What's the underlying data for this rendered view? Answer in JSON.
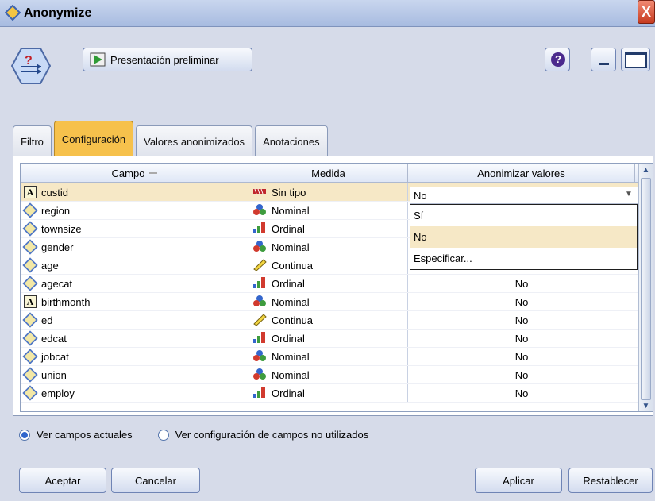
{
  "window": {
    "title": "Anonymize",
    "close_glyph": "X"
  },
  "toolbar": {
    "preview_label": "Presentación preliminar",
    "help_glyph": "?"
  },
  "tabs": [
    {
      "label": "Filtro"
    },
    {
      "label": "Configuración"
    },
    {
      "label": "Valores anonimizados"
    },
    {
      "label": "Anotaciones"
    }
  ],
  "table": {
    "headers": [
      "Campo",
      "Medida",
      "Anonimizar valores"
    ],
    "rows": [
      {
        "field": "custid",
        "type_icon": "text-field-icon",
        "measure": "Sin tipo",
        "measure_icon": "typeless-icon",
        "value": "No"
      },
      {
        "field": "region",
        "type_icon": "diamond-field-icon",
        "measure": "Nominal",
        "measure_icon": "nominal-icon",
        "value": ""
      },
      {
        "field": "townsize",
        "type_icon": "diamond-field-icon",
        "measure": "Ordinal",
        "measure_icon": "ordinal-icon",
        "value": ""
      },
      {
        "field": "gender",
        "type_icon": "diamond-field-icon",
        "measure": "Nominal",
        "measure_icon": "nominal-icon",
        "value": ""
      },
      {
        "field": "age",
        "type_icon": "diamond-field-icon",
        "measure": "Continua",
        "measure_icon": "continuous-icon",
        "value": "No"
      },
      {
        "field": "agecat",
        "type_icon": "diamond-field-icon",
        "measure": "Ordinal",
        "measure_icon": "ordinal-icon",
        "value": "No"
      },
      {
        "field": "birthmonth",
        "type_icon": "text-field-icon",
        "measure": "Nominal",
        "measure_icon": "nominal-icon",
        "value": "No"
      },
      {
        "field": "ed",
        "type_icon": "diamond-field-icon",
        "measure": "Continua",
        "measure_icon": "continuous-icon",
        "value": "No"
      },
      {
        "field": "edcat",
        "type_icon": "diamond-field-icon",
        "measure": "Ordinal",
        "measure_icon": "ordinal-icon",
        "value": "No"
      },
      {
        "field": "jobcat",
        "type_icon": "diamond-field-icon",
        "measure": "Nominal",
        "measure_icon": "nominal-icon",
        "value": "No"
      },
      {
        "field": "union",
        "type_icon": "diamond-field-icon",
        "measure": "Nominal",
        "measure_icon": "nominal-icon",
        "value": "No"
      },
      {
        "field": "employ",
        "type_icon": "diamond-field-icon",
        "measure": "Ordinal",
        "measure_icon": "ordinal-icon",
        "value": "No"
      }
    ]
  },
  "dropdown": {
    "selected": "No",
    "options": [
      "Sí",
      "No",
      "Especificar..."
    ]
  },
  "radios": [
    {
      "label": "Ver campos actuales",
      "checked": true
    },
    {
      "label": "Ver configuración de campos no utilizados",
      "checked": false
    }
  ],
  "buttons": {
    "ok": "Aceptar",
    "cancel": "Cancelar",
    "apply": "Aplicar",
    "reset": "Restablecer"
  }
}
